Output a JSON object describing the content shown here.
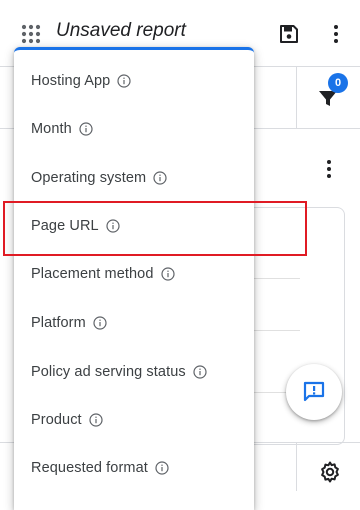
{
  "header": {
    "title": "Unsaved report",
    "apps_icon": "apps-grid-icon",
    "save_icon": "save-icon",
    "more_icon": "more-vert-icon"
  },
  "filter": {
    "icon": "filter-icon",
    "badge_count": "0"
  },
  "dimension_menu": {
    "info_icon": "info-outline-icon",
    "items": [
      {
        "label": "Hosting App"
      },
      {
        "label": "Month"
      },
      {
        "label": "Operating system"
      },
      {
        "label": "Page URL",
        "highlighted": true
      },
      {
        "label": "Placement method"
      },
      {
        "label": "Platform"
      },
      {
        "label": "Policy ad serving status"
      },
      {
        "label": "Product"
      },
      {
        "label": "Requested format"
      }
    ]
  },
  "fab": {
    "icon": "feedback-icon"
  },
  "footer": {
    "settings_icon": "settings-gear-icon"
  },
  "colors": {
    "accent": "#1a73e8",
    "highlight": "#e01b24",
    "text": "#3c4043",
    "icon": "#5f6368"
  }
}
